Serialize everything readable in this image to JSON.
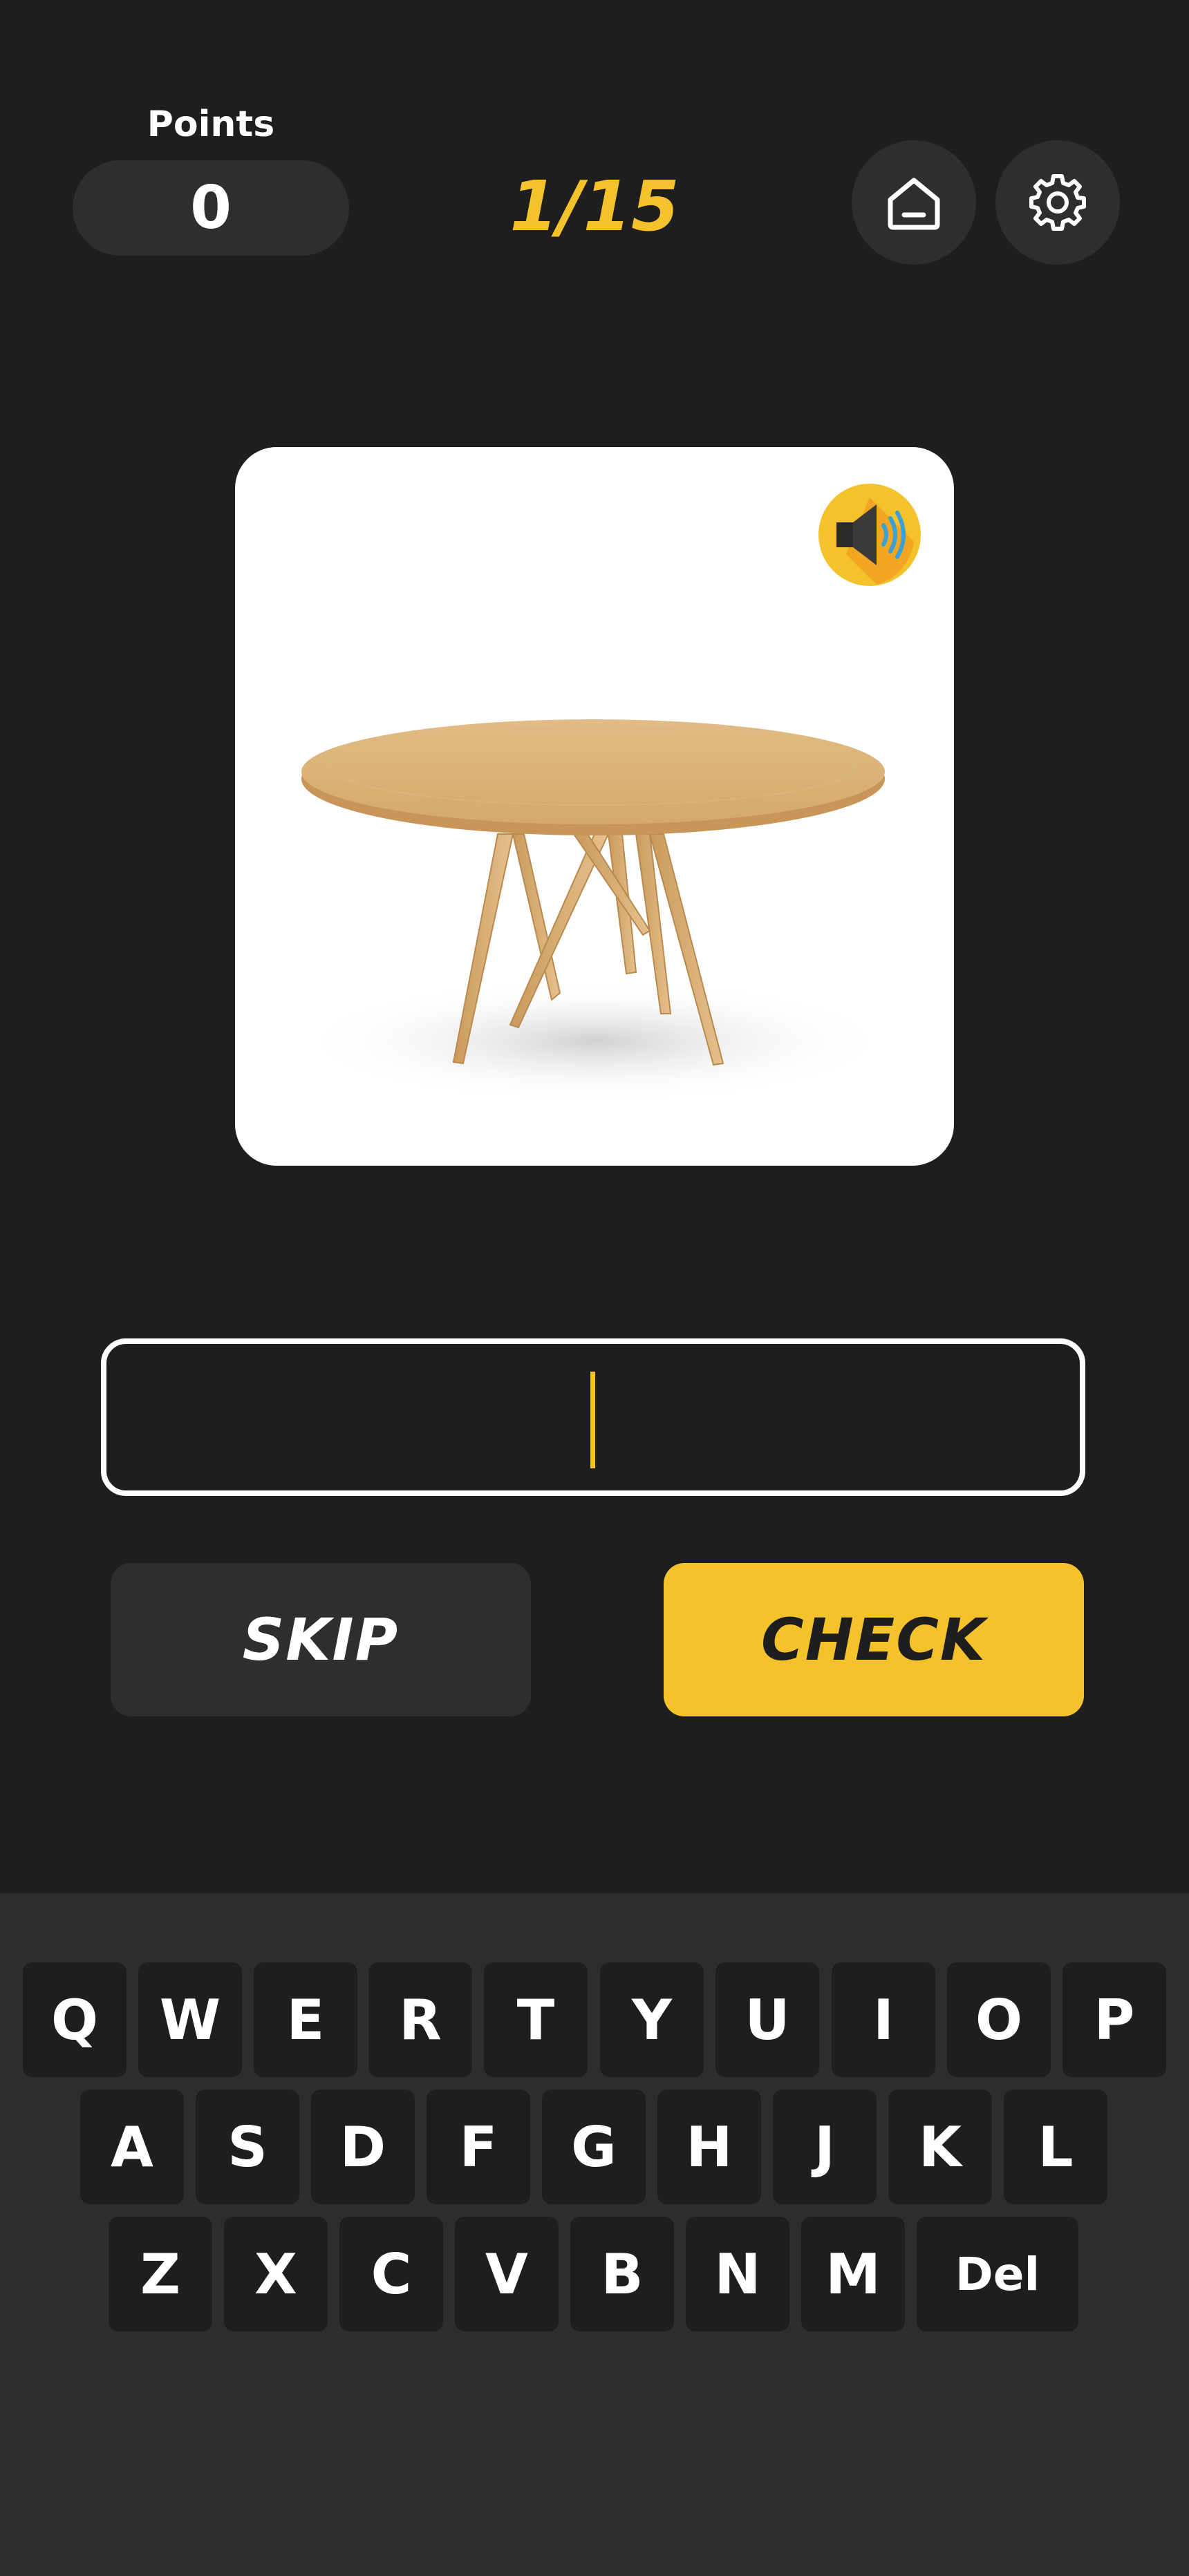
{
  "header": {
    "points_label": "Points",
    "points_value": "0",
    "progress": "1/15",
    "home_icon": "home-icon",
    "settings_icon": "gear-icon"
  },
  "picture": {
    "sound_icon": "speaker-icon"
  },
  "answer": {
    "value": ""
  },
  "actions": {
    "skip_label": "SKIP",
    "check_label": "CHECK"
  },
  "keyboard": {
    "row1": [
      "Q",
      "W",
      "E",
      "R",
      "T",
      "Y",
      "U",
      "I",
      "O",
      "P"
    ],
    "row2": [
      "A",
      "S",
      "D",
      "F",
      "G",
      "H",
      "J",
      "K",
      "L"
    ],
    "row3": [
      "Z",
      "X",
      "C",
      "V",
      "B",
      "N",
      "M"
    ],
    "del_label": "Del"
  },
  "colors": {
    "background": "#1e1e1e",
    "accent": "#f4c22b",
    "surface": "#2e2e2e"
  }
}
